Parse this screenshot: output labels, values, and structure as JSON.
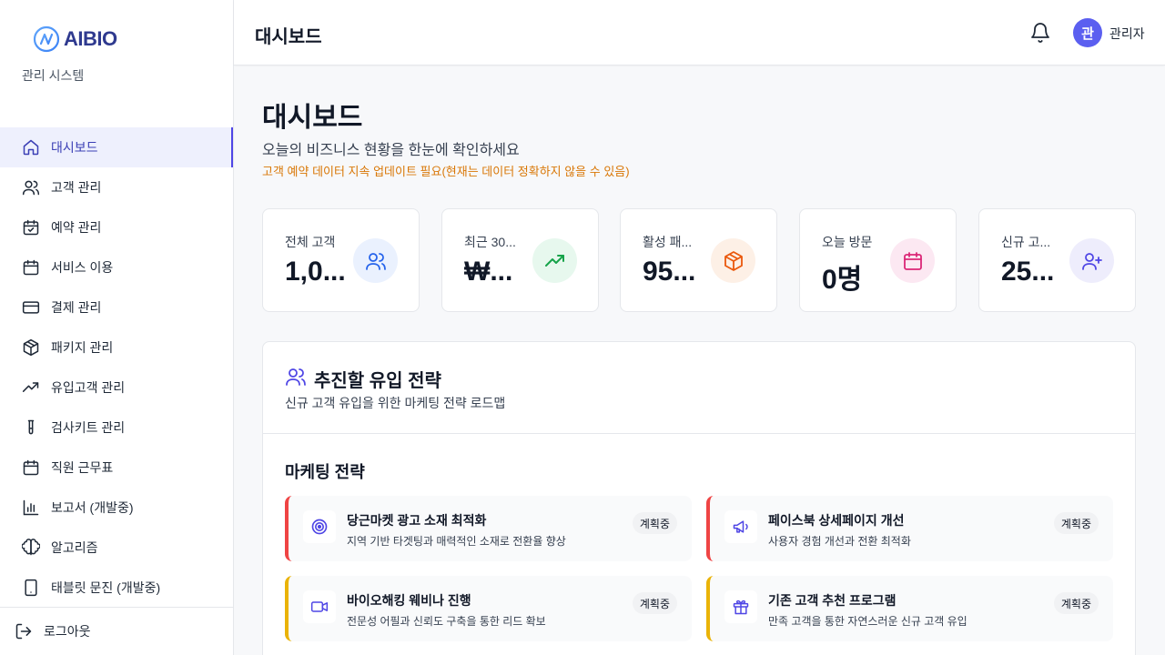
{
  "brand": {
    "name": "AIBIO",
    "subtitle": "관리 시스템"
  },
  "sidebar": {
    "items": [
      {
        "label": "대시보드",
        "icon": "home-icon",
        "active": true
      },
      {
        "label": "고객 관리",
        "icon": "users-icon"
      },
      {
        "label": "예약 관리",
        "icon": "calendar-check-icon"
      },
      {
        "label": "서비스 이용",
        "icon": "calendar-icon"
      },
      {
        "label": "결제 관리",
        "icon": "credit-card-icon"
      },
      {
        "label": "패키지 관리",
        "icon": "package-icon"
      },
      {
        "label": "유입고객 관리",
        "icon": "trending-up-icon"
      },
      {
        "label": "검사키트 관리",
        "icon": "test-tube-icon"
      },
      {
        "label": "직원 근무표",
        "icon": "calendar-icon"
      },
      {
        "label": "보고서 (개발중)",
        "icon": "bar-chart-icon"
      },
      {
        "label": "알고리즘",
        "icon": "brain-icon"
      },
      {
        "label": "태블릿 문진 (개발중)",
        "icon": "tablet-icon"
      }
    ],
    "logout_label": "로그아웃"
  },
  "header": {
    "title": "대시보드",
    "avatar_initial": "관",
    "user_name": "관리자"
  },
  "main": {
    "title": "대시보드",
    "description": "오늘의 비즈니스 현황을 한눈에 확인하세요",
    "warning": "고객 예약 데이터 지속 업데이트 필요(현재는 데이터 정확하지 않을 수 있음)",
    "stats": [
      {
        "label": "전체 고객",
        "value": "1,0...",
        "icon": "users-icon",
        "color": "#2563eb",
        "bg": "#eaf1fe"
      },
      {
        "label": "최근 30...",
        "value": "₩...",
        "icon": "trending-up-icon",
        "color": "#16a34a",
        "bg": "#e7f8ee"
      },
      {
        "label": "활성 패...",
        "value": "95...",
        "icon": "package-icon",
        "color": "#ea580c",
        "bg": "#fdf0e6"
      },
      {
        "label": "오늘 방문",
        "value": "0명",
        "icon": "calendar-icon",
        "color": "#db2777",
        "bg": "#fce8f2"
      },
      {
        "label": "신규 고...",
        "value": "25...",
        "icon": "user-plus-icon",
        "color": "#4f46e5",
        "bg": "#eeedfc"
      }
    ],
    "strategy": {
      "title": "추진할 유입 전략",
      "description": "신규 고객 유입을 위한 마케팅 전략 로드맵",
      "section_title": "마케팅 전략",
      "cards": [
        {
          "title": "당근마켓 광고 소재 최적화",
          "desc": "지역 기반 타겟팅과 매력적인 소재로 전환율 향상",
          "status": "계획중",
          "icon": "target-icon",
          "priority_color": "#ef4444"
        },
        {
          "title": "페이스북 상세페이지 개선",
          "desc": "사용자 경험 개선과 전환 최적화",
          "status": "계획중",
          "icon": "megaphone-icon",
          "priority_color": "#ef4444"
        },
        {
          "title": "바이오해킹 웨비나 진행",
          "desc": "전문성 어필과 신뢰도 구축을 통한 리드 확보",
          "status": "계획중",
          "icon": "video-icon",
          "priority_color": "#eab308"
        },
        {
          "title": "기존 고객 추천 프로그램",
          "desc": "만족 고객을 통한 자연스러운 신규 고객 유입",
          "status": "계획중",
          "icon": "gift-icon",
          "priority_color": "#eab308"
        }
      ]
    }
  }
}
